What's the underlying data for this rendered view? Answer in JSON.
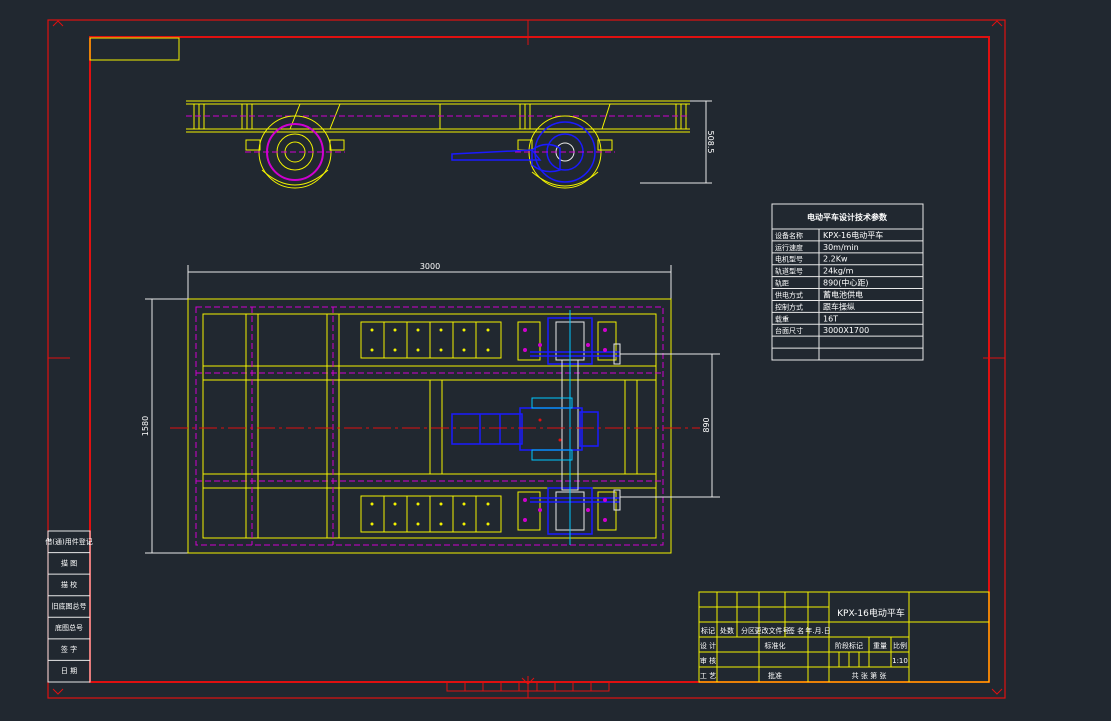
{
  "drawing": {
    "title": "KPX-16电动平车",
    "scale": "1:10",
    "dimensions": {
      "overall_length": "3000",
      "overall_width": "1580",
      "track_gauge": "890",
      "height": "508.5"
    },
    "spec_table": {
      "title": "电动平车设计技术参数",
      "rows": [
        {
          "label": "设备名称",
          "value": "KPX-16电动平车"
        },
        {
          "label": "运行速度",
          "value": "30m/min"
        },
        {
          "label": "电机型号",
          "value": "2.2Kw"
        },
        {
          "label": "轨道型号",
          "value": "24kg/m"
        },
        {
          "label": "轨距",
          "value": "890(中心距)"
        },
        {
          "label": "供电方式",
          "value": "蓄电池供电"
        },
        {
          "label": "控制方式",
          "value": "跟车操纵"
        },
        {
          "label": "载重",
          "value": "16T"
        },
        {
          "label": "台面尺寸",
          "value": "3000X1700"
        },
        {
          "label": "",
          "value": ""
        },
        {
          "label": "",
          "value": ""
        }
      ]
    },
    "left_strip_labels": [
      "借(通)用件登记",
      "描 图",
      "描 校",
      "旧底图总号",
      "底图总号",
      "签 字",
      "日 期"
    ],
    "title_block": {
      "revision_headers": [
        "标记",
        "处数",
        "分区",
        "更改文件号",
        "签 名",
        "年.月.日"
      ],
      "row_labels": [
        "设 计",
        "标准化",
        "审 核",
        "工 艺",
        "批准"
      ],
      "stage_label": "阶段标记",
      "weight_label": "重量",
      "scale_label": "比例",
      "sheets_label": "共 张 第 张"
    }
  }
}
